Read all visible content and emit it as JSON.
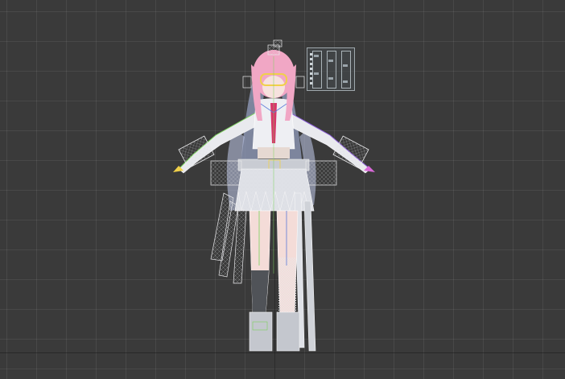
{
  "viewport": {
    "background_color": "#3a3a3a",
    "grid_color": "#4a4a4a",
    "wireframe_color": "#e8e8ea",
    "accent_colors": {
      "hair": "#f1a7c5",
      "tie": "#d8356a",
      "goggles": "#f0d04a",
      "bone_green": "#7ad35a",
      "bone_blue": "#5a7ad8",
      "bone_purple": "#8a5ad8"
    }
  },
  "character": {
    "name_icon": "anime-girl-t-pose-wireframe-icon"
  },
  "control_panel": {
    "icon": "rig-controls-icon",
    "rows": 8
  }
}
